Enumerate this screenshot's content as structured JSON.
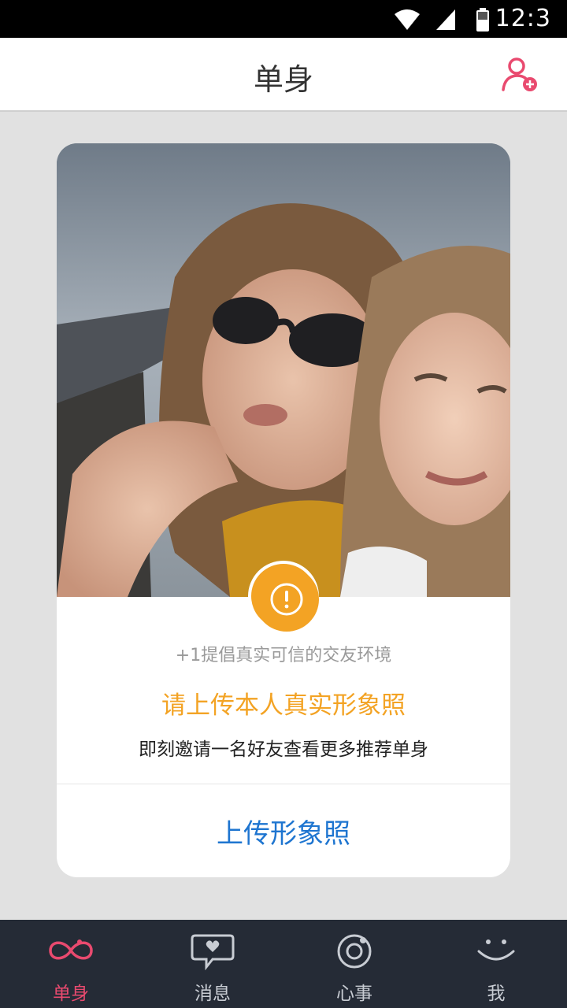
{
  "status_bar": {
    "time": "12:3"
  },
  "header": {
    "title": "单身",
    "action_icon": "add-user-icon"
  },
  "card": {
    "photo_alt": "",
    "badge_icon": "exclamation-icon",
    "subtitle": "+1提倡真实可信的交友环境",
    "headline": "请上传本人真实形象照",
    "description": "即刻邀请一名好友查看更多推荐单身",
    "upload_label": "上传形象照"
  },
  "tabs": [
    {
      "label": "单身",
      "icon": "infinity-icon",
      "active": true
    },
    {
      "label": "消息",
      "icon": "chat-heart-icon",
      "active": false
    },
    {
      "label": "心事",
      "icon": "camera-lens-icon",
      "active": false
    },
    {
      "label": "我",
      "icon": "smiley-face-icon",
      "active": false
    }
  ],
  "colors": {
    "accent_pink": "#e94a6f",
    "accent_orange": "#f3a324",
    "link_blue": "#1e75d0",
    "tabbar_bg": "#252b36"
  }
}
